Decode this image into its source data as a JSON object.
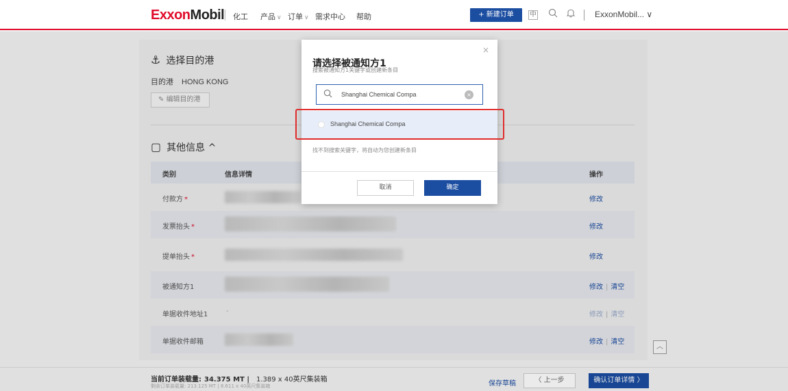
{
  "header": {
    "logo_part1": "Exxon",
    "logo_part2": "Mobil",
    "nav": [
      "化工",
      "产品",
      "订单",
      "需求中心",
      "帮助"
    ],
    "new_order": "+ 新建订单",
    "account": "ExxonMobil... ∨",
    "icons": [
      "lang-icon",
      "search-icon",
      "bell-icon"
    ],
    "lang_glyph": "中"
  },
  "page": {
    "port_section": {
      "title": "选择目的港",
      "port_label": "目的港",
      "port_value": "HONG KONG",
      "edit_button": "编辑目的港"
    },
    "other_section": {
      "title": "其他信息 ^"
    },
    "table": {
      "headers": {
        "category": "类别",
        "detail": "信息详情",
        "action": "操作"
      },
      "rows": [
        {
          "label": "付款方",
          "required": "*",
          "actions": [
            "修改"
          ]
        },
        {
          "label": "发票抬头",
          "required": "*",
          "actions": [
            "修改"
          ]
        },
        {
          "label": "提单抬头",
          "required": "*",
          "actions": [
            "修改"
          ]
        },
        {
          "label": "被通知方1",
          "required": "",
          "actions": [
            "修改",
            "清空"
          ]
        },
        {
          "label": "单据收件地址1",
          "required": "",
          "dash": "-",
          "actions": [
            "修改",
            "清空"
          ]
        },
        {
          "label": "单据收件邮箱",
          "required": "",
          "actions": [
            "修改",
            "清空"
          ]
        }
      ]
    }
  },
  "footer": {
    "qty_label": "当前订单装载量:",
    "qty_value": "34.375 MT |",
    "container": "1.389 x 40英尺集装箱",
    "sub_text": "剩余订单装载量: 213.125 MT   |   8.611 x 40英尺集装箱",
    "save_draft": "保存草稿",
    "prev": "〈 上一步",
    "confirm": "确认订单详情 〉"
  },
  "modal": {
    "title": "请选择被通知方1",
    "subtitle": "搜索被通知方1关键字或创建新条目",
    "search_value": "Shanghai Chemical Compa",
    "option": "Shanghai Chemical Compa",
    "hint": "找不到搜索关键字，将自动为您创建新条目",
    "cancel": "取消",
    "ok": "确定",
    "close": "×"
  },
  "colors": {
    "brand_red": "#e00b2a",
    "primary_blue": "#1b4da1",
    "highlight": "#e02b2b"
  }
}
